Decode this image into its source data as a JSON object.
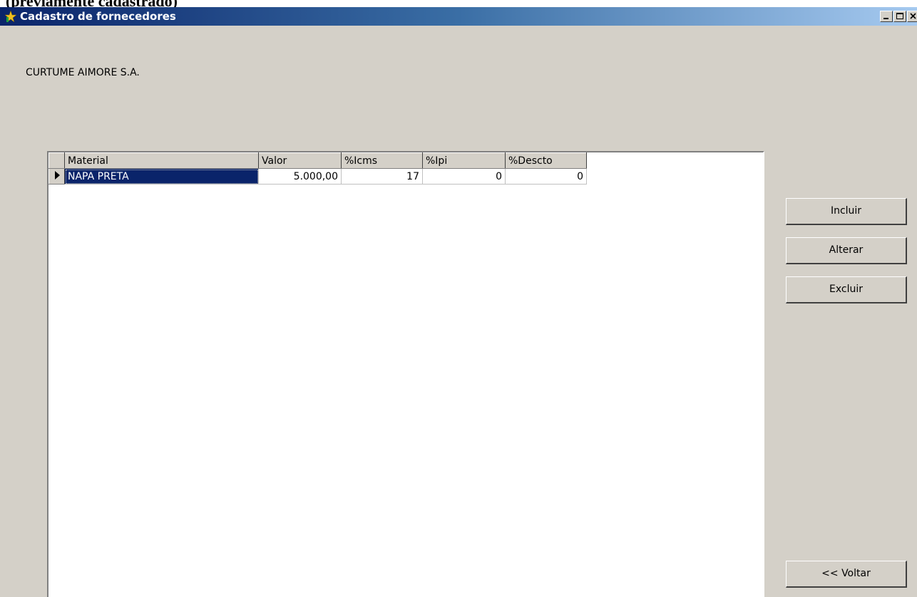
{
  "caption": "(previamente cadastrado)",
  "window": {
    "title": "Cadastro de fornecedores",
    "minimize_label": "minimize",
    "maximize_label": "maximize",
    "close_label": "close"
  },
  "company_name": "CURTUME AIMORE S.A.",
  "grid": {
    "columns": [
      "Material",
      "Valor",
      "%Icms",
      "%Ipi",
      "%Descto"
    ],
    "rows": [
      [
        "NAPA PRETA",
        "5.000,00",
        "17",
        "0",
        "0"
      ]
    ]
  },
  "buttons": {
    "incluir": "Incluir",
    "alterar": "Alterar",
    "excluir": "Excluir",
    "voltar": "<< Voltar"
  },
  "colors": {
    "titlebar_start": "#0a246a",
    "titlebar_end": "#a6caf0",
    "window_bg": "#d4d0c8",
    "selection": "#0a246a"
  },
  "icons": {
    "app": "app-icon",
    "row_indicator": "row-pointer-icon"
  }
}
